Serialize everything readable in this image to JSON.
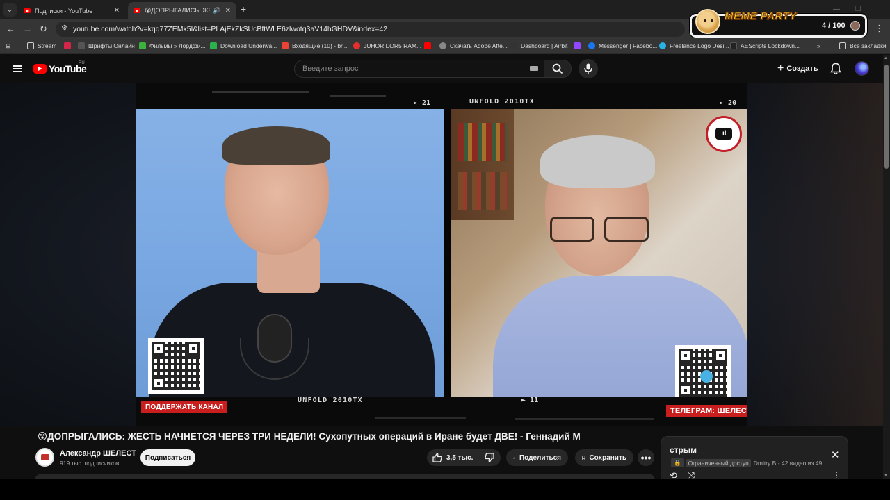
{
  "browser": {
    "tabs": [
      {
        "title": "Подписки - YouTube",
        "active": false
      },
      {
        "title": "😵ДОПРЫГАЛИСЬ: ЖЕСТЬ",
        "active": true
      }
    ],
    "url": "youtube.com/watch?v=kqq77ZEMk5I&list=PLAjEkZkSUcBftWLE6zlwotq3aV14hGHDV&index=42",
    "bookmarks": [
      {
        "label": "Stream",
        "icon": "folder-icon",
        "color": "#cfcfcf"
      },
      {
        "label": "",
        "icon": "bookmark-red-icon",
        "color": "#d3244a"
      },
      {
        "label": "Шрифты Онлайн",
        "icon": "font-icon",
        "color": "#555555"
      },
      {
        "label": "Фильмы » Лордфи...",
        "icon": "film-icon",
        "color": "#3cb43c"
      },
      {
        "label": "Download Underwa...",
        "icon": "download-icon",
        "color": "#2bb24c"
      },
      {
        "label": "Входящие (10) - br...",
        "icon": "gmail-icon",
        "color": "#ea4335"
      },
      {
        "label": "JUHOR DDR5 RAM...",
        "icon": "aliexpress-icon",
        "color": "#e62e2e"
      },
      {
        "label": "",
        "icon": "youtube-icon",
        "color": "#ff0000"
      },
      {
        "label": "Скачать Adobe Afte...",
        "icon": "globe-icon",
        "color": "#cfcfcf"
      },
      {
        "label": "Dashboard | Airbit",
        "icon": "airbit-icon",
        "color": "#333333"
      },
      {
        "label": "",
        "icon": "twitch-icon",
        "color": "#9146ff"
      },
      {
        "label": "Messenger | Facebo...",
        "icon": "facebook-icon",
        "color": "#1877f2"
      },
      {
        "label": "Freelance Logo Desi...",
        "icon": "freelance-icon",
        "color": "#29b2e6"
      },
      {
        "label": "AEScripts Lockdown...",
        "icon": "aescripts-icon",
        "color": "#222222"
      }
    ],
    "all_bookmarks_label": "Все закладки"
  },
  "meme_party": {
    "title": "MEME PARTY",
    "counter": "4 / 100"
  },
  "youtube": {
    "logo_text": "YouTube",
    "country": "RU",
    "search_placeholder": "Введите запрос",
    "create_label": "Создать"
  },
  "video_overlay": {
    "label_top": "UNFOLD 2010TX",
    "label_bottom": "UNFOLD 2010TX",
    "num_top_left": "21",
    "num_top_right": "20",
    "num_bottom_right": "11",
    "support_badge": "ПОДДЕРЖАТЬ КАНАЛ",
    "telegram_badge": "ТЕЛЕГРАМ: ШЕЛЕСТ"
  },
  "video": {
    "title": "😵ДОПРЫГАЛИСЬ: ЖЕСТЬ НАЧНЕТСЯ ЧЕРЕЗ ТРИ НЕДЕЛИ! Сухопутных операций в Иране будет ДВЕ! - Геннадий М",
    "channel_name": "Александр ШЕЛЕСТ",
    "subscribers": "919 тыс. подписчиков",
    "subscribe_label": "Подписаться",
    "likes": "3,5 тыс.",
    "share_label": "Поделиться",
    "save_label": "Сохранить"
  },
  "playlist": {
    "title": "стрым",
    "access": "Ограниченный доступ",
    "meta": "Dmitry B - 42 видео из 49"
  },
  "colors": {
    "youtube_red": "#ff0000",
    "badge_red": "#c81e1e",
    "meme_yellow": "#ffd53a"
  }
}
